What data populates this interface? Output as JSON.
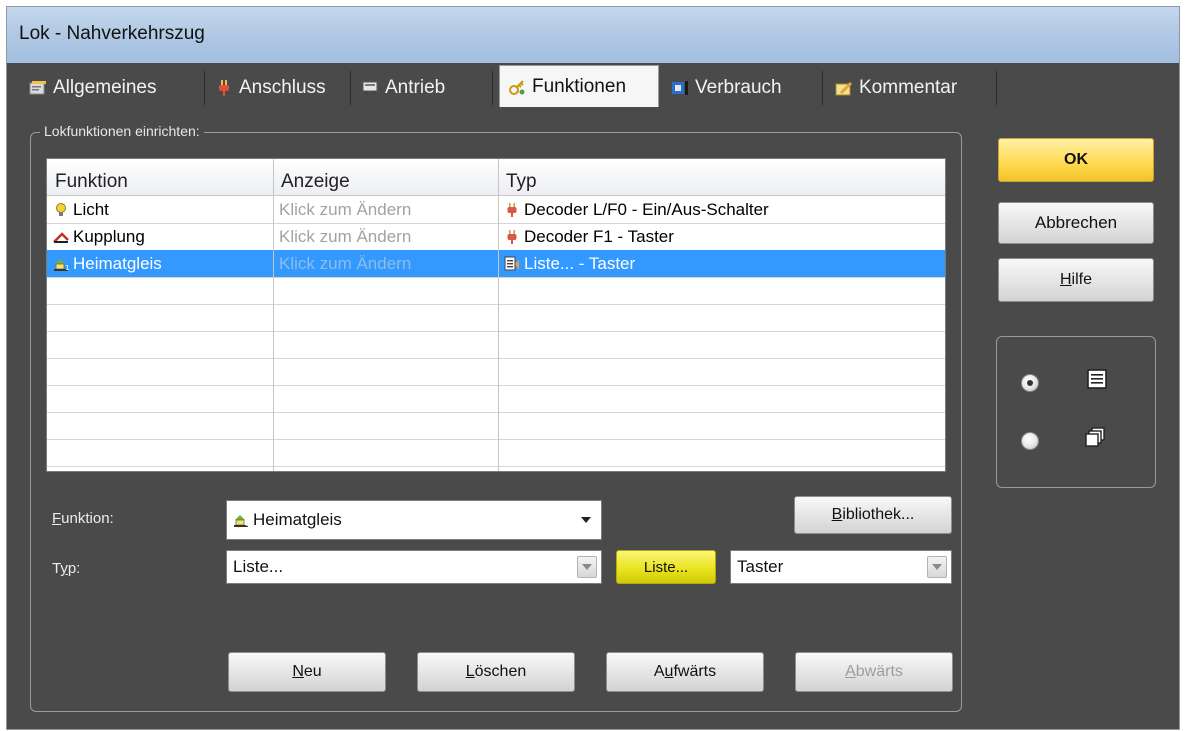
{
  "window": {
    "title": "Lok - Nahverkehrszug"
  },
  "tabs": [
    {
      "label": "Allgemeines",
      "icon": "general-card-icon",
      "active": false
    },
    {
      "label": "Anschluss",
      "icon": "plug-icon",
      "active": false
    },
    {
      "label": "Antrieb",
      "icon": "engine-icon",
      "active": false
    },
    {
      "label": "Funktionen",
      "icon": "functions-key-icon",
      "active": true
    },
    {
      "label": "Verbrauch",
      "icon": "consumption-icon",
      "active": false
    },
    {
      "label": "Kommentar",
      "icon": "pencil-note-icon",
      "active": false
    }
  ],
  "group": {
    "title": "Lokfunktionen einrichten:"
  },
  "table": {
    "columns": [
      "Funktion",
      "Anzeige",
      "Typ"
    ],
    "rows": [
      {
        "funktion": "Licht",
        "funktion_icon": "light-bulb-icon",
        "anzeige": "Klick zum Ändern",
        "typ": "Decoder L/F0 - Ein/Aus-Schalter",
        "typ_icon": "decoder-plug-icon",
        "selected": false
      },
      {
        "funktion": "Kupplung",
        "funktion_icon": "coupling-icon",
        "anzeige": "Klick zum Ändern",
        "typ": "Decoder F1 - Taster",
        "typ_icon": "decoder-plug-icon",
        "selected": false
      },
      {
        "funktion": "Heimatgleis",
        "funktion_icon": "home-track-icon",
        "anzeige": "Klick zum Ändern",
        "typ": "Liste... - Taster",
        "typ_icon": "list-icon",
        "selected": true
      }
    ]
  },
  "form": {
    "funktion_label_accel": "F",
    "funktion_label_rest": "unktion:",
    "funktion_value": "Heimatgleis",
    "funktion_icon": "home-track-icon",
    "typ_label_pre": "T",
    "typ_label_accel": "y",
    "typ_label_post": "p:",
    "typ_value": "Liste...",
    "liste_button": "Liste...",
    "taster_value": "Taster",
    "bibliothek_accel": "B",
    "bibliothek_rest": "ibliothek..."
  },
  "buttons": {
    "neu_accel": "N",
    "neu_rest": "eu",
    "loeschen_accel": "L",
    "loeschen_rest": "öschen",
    "aufwaerts_pre": "A",
    "aufwaerts_accel": "u",
    "aufwaerts_post": "fwärts",
    "abwaerts_accel": "A",
    "abwaerts_rest": "bwärts",
    "ok": "OK",
    "abbrechen": "Abbrechen",
    "hilfe_accel": "H",
    "hilfe_rest": "ilfe"
  },
  "view": {
    "options": [
      {
        "icon": "list-view-icon",
        "selected": true
      },
      {
        "icon": "tile-view-icon",
        "selected": false
      }
    ]
  },
  "colors": {
    "dialog_bg": "#4a4a4a",
    "selection": "#3399ff",
    "ok_button": "#ffd84d",
    "liste_button": "#e8e21a"
  }
}
